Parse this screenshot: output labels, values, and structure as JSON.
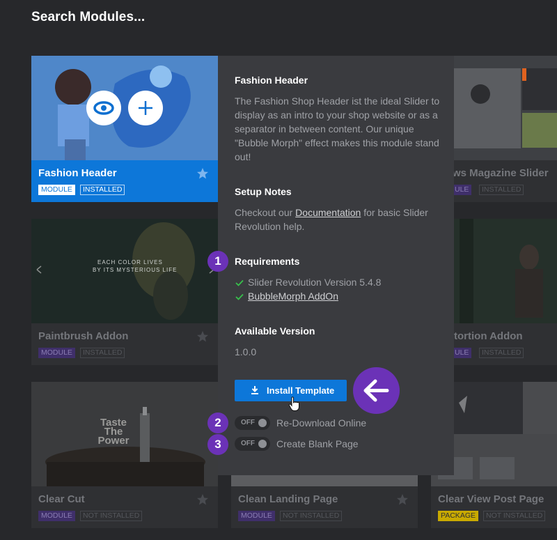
{
  "header": {
    "title": "Search Modules..."
  },
  "colors": {
    "accent": "#0d77d9",
    "purple": "#6b32b7",
    "module_badge": "#5b3fa8",
    "package_badge": "#d6b400"
  },
  "cards": {
    "fashion": {
      "title": "Fashion Header",
      "type": "MODULE",
      "status": "INSTALLED"
    },
    "news": {
      "title": "ws Magazine Slider",
      "type": "ULE",
      "status": "INSTALLED"
    },
    "paintbrush": {
      "title": "Paintbrush Addon",
      "type": "MODULE",
      "status": "INSTALLED",
      "thumb_line1": "EACH COLOR LIVES",
      "thumb_line2": "BY ITS MYSTERIOUS LIFE"
    },
    "distortion": {
      "title": "tortion Addon",
      "type": "ULE",
      "status": "INSTALLED"
    },
    "clearcut": {
      "title": "Clear Cut",
      "type": "MODULE",
      "status": "NOT INSTALLED",
      "thumb_text": "Taste The Power"
    },
    "landing": {
      "title": "Clean Landing Page",
      "type": "MODULE",
      "status": "NOT INSTALLED"
    },
    "clearview": {
      "title": "Clear View Post Page",
      "type": "PACKAGE",
      "status": "NOT INSTALLED"
    }
  },
  "detail": {
    "title": "Fashion Header",
    "description": "The Fashion Shop Header ist the ideal Slider to display as an intro to your shop website or as a separator in between content. Our unique \"Bubble Morph\" effect makes this module stand out!",
    "setup_heading": "Setup Notes",
    "setup_pre": "Checkout our ",
    "setup_link": "Documentation",
    "setup_post": " for basic Slider Revolution help.",
    "req_heading": "Requirements",
    "requirements": [
      "Slider Revolution Version 5.4.8",
      "BubbleMorph AddOn"
    ],
    "version_heading": "Available Version",
    "version": "1.0.0",
    "install_label": "Install Template",
    "toggle_off": "OFF",
    "redownload_label": "Re-Download Online",
    "blank_label": "Create Blank Page"
  },
  "callouts": [
    "1",
    "2",
    "3"
  ]
}
